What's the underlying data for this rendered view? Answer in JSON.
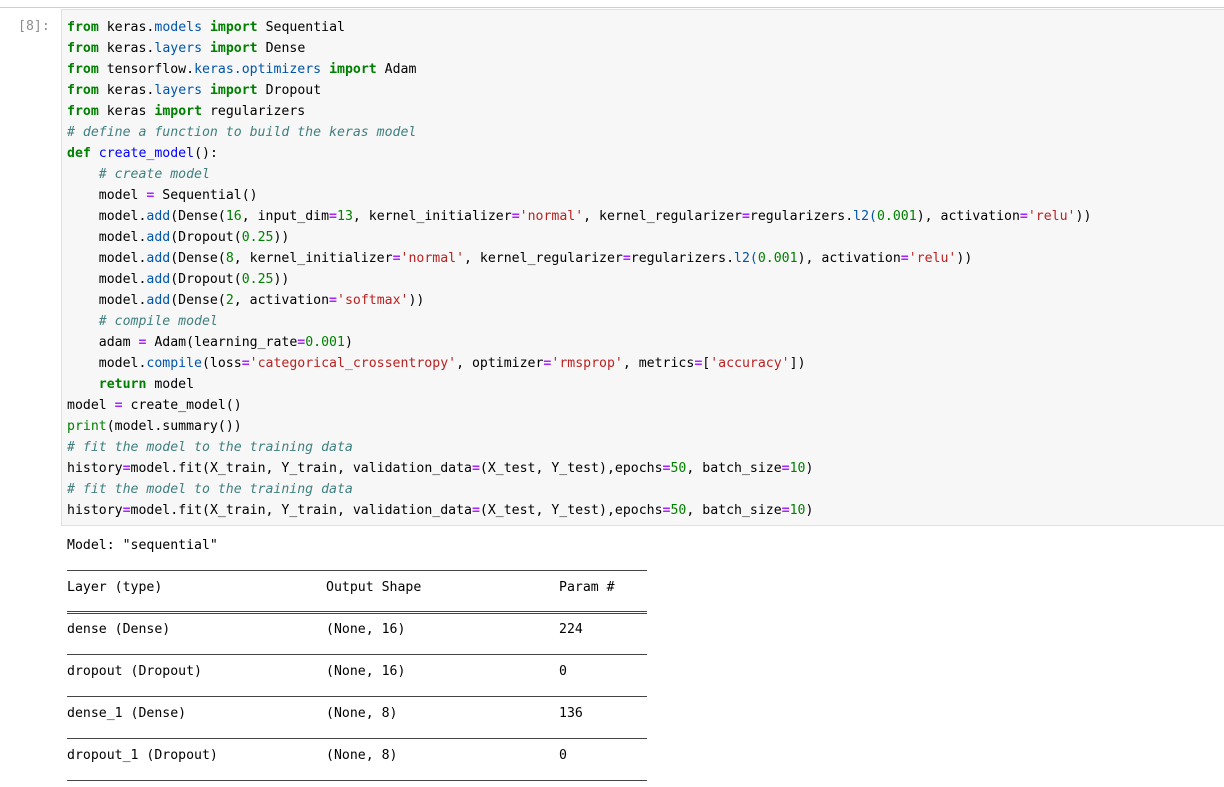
{
  "cell": {
    "prompt": "[8]:"
  },
  "code": {
    "l1": [
      "from",
      "keras",
      ".",
      "models",
      "import",
      "Sequential"
    ],
    "l2": [
      "from",
      "keras",
      ".",
      "layers",
      "import",
      "Dense"
    ],
    "l3": [
      "from",
      "tensorflow",
      ".",
      "keras.optimizers",
      "import",
      "Adam"
    ],
    "l4": [
      "from",
      "keras",
      ".",
      "layers",
      "import",
      "Dropout"
    ],
    "l5": [
      "from",
      "keras",
      "import",
      "regularizers"
    ],
    "l6": "# define a function to build the keras model",
    "l7": [
      "def",
      "create_model",
      "():"
    ],
    "l8": "# create model",
    "l9": [
      "model ",
      "=",
      " Sequential()"
    ],
    "l10": [
      "model.",
      "add",
      "(Dense(",
      "16",
      ", input_dim",
      "=",
      "13",
      ", kernel_initializer",
      "=",
      "'normal'",
      ", kernel_regularizer",
      "=",
      "regularizers",
      ".",
      "l2(",
      "0.001",
      "), activation",
      "=",
      "'relu'",
      "))"
    ],
    "l11": [
      "model.",
      "add",
      "(Dropout(",
      "0.25",
      "))"
    ],
    "l12": [
      "model.",
      "add",
      "(Dense(",
      "8",
      ", kernel_initializer",
      "=",
      "'normal'",
      ", kernel_regularizer",
      "=",
      "regularizers",
      ".",
      "l2(",
      "0.001",
      "), activation",
      "=",
      "'relu'",
      "))"
    ],
    "l13": [
      "model.",
      "add",
      "(Dropout(",
      "0.25",
      "))"
    ],
    "l14": [
      "model.",
      "add",
      "(Dense(",
      "2",
      ", activation",
      "=",
      "'softmax'",
      "))"
    ],
    "l15": "# compile model",
    "l16": [
      "adam ",
      "=",
      " Adam(learning_rate",
      "=",
      "0.001",
      ")"
    ],
    "l17": [
      "model.",
      "compile",
      "(loss",
      "=",
      "'categorical_crossentropy'",
      ", optimizer",
      "=",
      "'rmsprop'",
      ", metrics",
      "=",
      "[",
      "'accuracy'",
      "])"
    ],
    "l18": [
      "return",
      " model"
    ],
    "l19": [
      "model ",
      "=",
      " create_model()"
    ],
    "l20": [
      "print",
      "(model",
      ".",
      "summary())"
    ],
    "l21": "# fit the model to the training data",
    "l22": [
      "history",
      "=",
      "model",
      ".",
      "fit(X_train, Y_train, validation_data",
      "=",
      "(X_test, Y_test),epochs",
      "=",
      "50",
      ", batch_size",
      "=",
      "10",
      ")"
    ],
    "l23": "# fit the model to the training data",
    "l24": [
      "history",
      "=",
      "model",
      ".",
      "fit(X_train, Y_train, validation_data",
      "=",
      "(X_test, Y_test),epochs",
      "=",
      "50",
      ", batch_size",
      "=",
      "10",
      ")"
    ]
  },
  "output": {
    "model_line": "Model: \"sequential\"",
    "headers": [
      "Layer (type)",
      "Output Shape",
      "Param #"
    ],
    "rows": [
      [
        "dense (Dense)",
        "(None, 16)",
        "224"
      ],
      [
        "dropout (Dropout)",
        "(None, 16)",
        "0"
      ],
      [
        "dense_1 (Dense)",
        "(None, 8)",
        "136"
      ],
      [
        "dropout_1 (Dropout)",
        "(None, 8)",
        "0"
      ]
    ]
  }
}
